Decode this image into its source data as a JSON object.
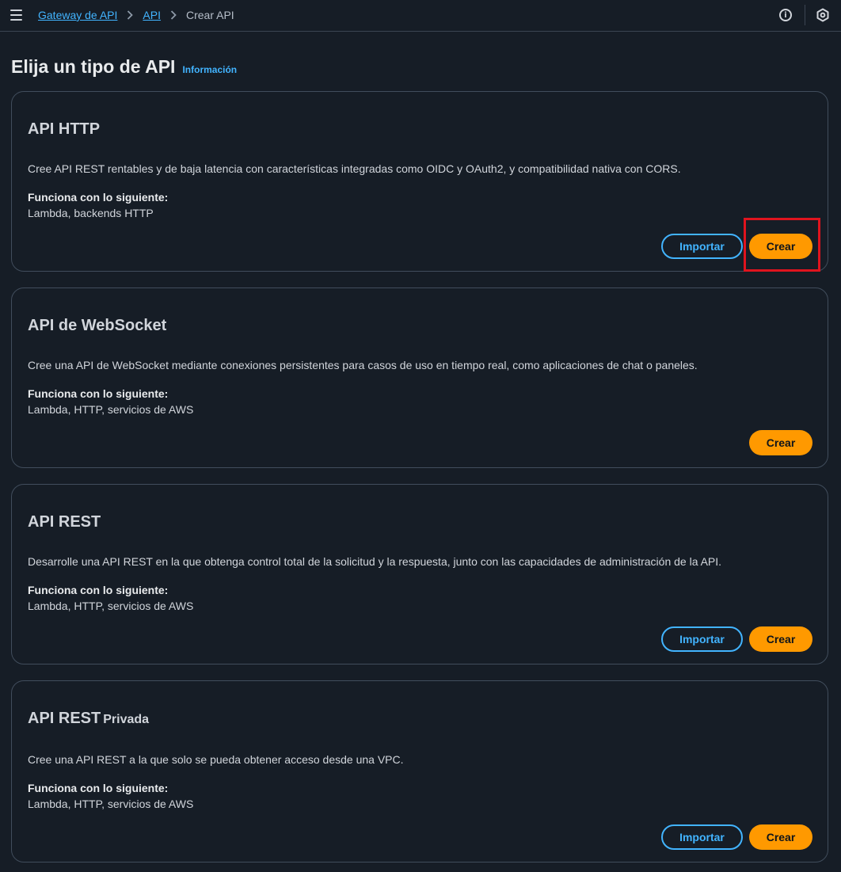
{
  "breadcrumb": {
    "items": [
      "Gateway de API",
      "API"
    ],
    "current": "Crear API"
  },
  "page": {
    "title": "Elija un tipo de API",
    "info_link": "Información"
  },
  "cards": [
    {
      "title": "API HTTP",
      "title_suffix": "",
      "description": "Cree API REST rentables y de baja latencia con características integradas como OIDC y OAuth2, y compatibilidad nativa con CORS.",
      "works_label": "Funciona con lo siguiente:",
      "works_value": "Lambda, backends HTTP",
      "import_label": "Importar",
      "create_label": "Crear"
    },
    {
      "title": "API de WebSocket",
      "title_suffix": "",
      "description": "Cree una API de WebSocket mediante conexiones persistentes para casos de uso en tiempo real, como aplicaciones de chat o paneles.",
      "works_label": "Funciona con lo siguiente:",
      "works_value": "Lambda, HTTP, servicios de AWS",
      "create_label": "Crear"
    },
    {
      "title": "API REST",
      "title_suffix": "",
      "description": "Desarrolle una API REST en la que obtenga control total de la solicitud y la respuesta, junto con las capacidades de administración de la API.",
      "works_label": "Funciona con lo siguiente:",
      "works_value": "Lambda, HTTP, servicios de AWS",
      "import_label": "Importar",
      "create_label": "Crear"
    },
    {
      "title": "API REST",
      "title_suffix": "Privada",
      "description": "Cree una API REST a la que solo se pueda obtener acceso desde una VPC.",
      "works_label": "Funciona con lo siguiente:",
      "works_value": "Lambda, HTTP, servicios de AWS",
      "import_label": "Importar",
      "create_label": "Crear"
    }
  ],
  "colors": {
    "background": "#161d26",
    "link": "#42b4ff",
    "primary": "#ff9900",
    "highlight": "#e0141e"
  },
  "icons": [
    "menu-icon",
    "chevron-right-icon",
    "info-icon",
    "settings-icon"
  ]
}
